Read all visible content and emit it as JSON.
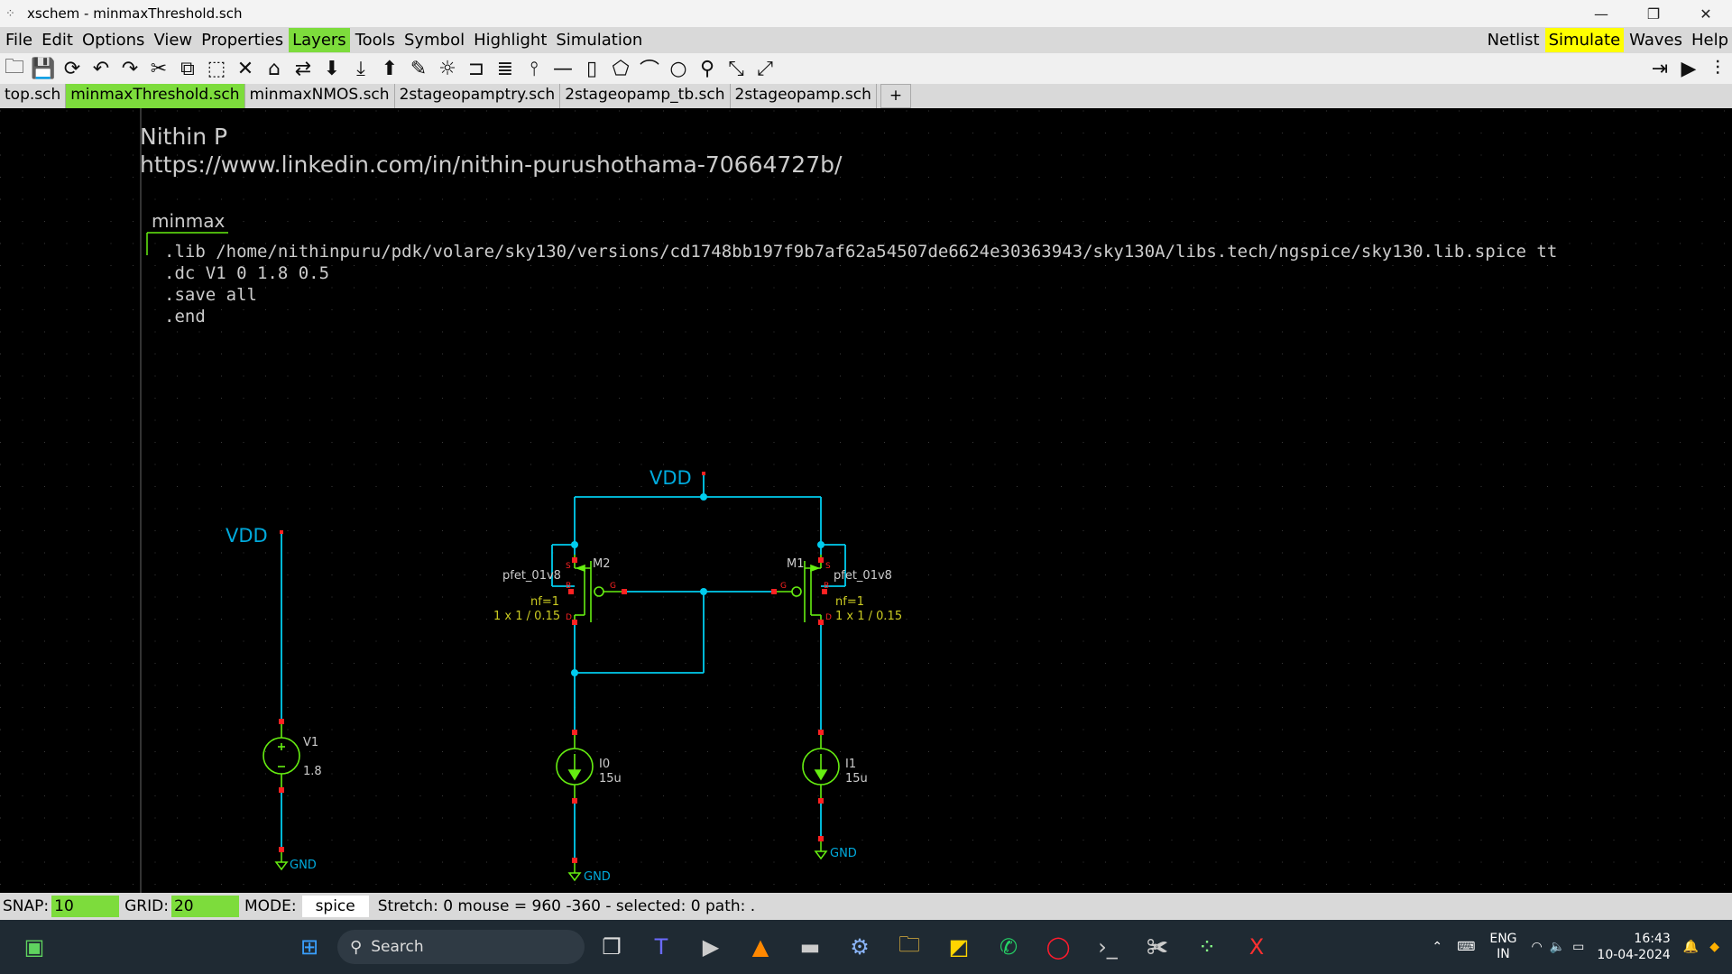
{
  "window": {
    "title": "xschem - minmaxThreshold.sch"
  },
  "menu": {
    "items": [
      "File",
      "Edit",
      "Options",
      "View",
      "Properties",
      "Layers",
      "Tools",
      "Symbol",
      "Highlight",
      "Simulation"
    ],
    "active": "Layers",
    "right": [
      "Netlist",
      "Simulate",
      "Waves",
      "Help"
    ]
  },
  "tabs": [
    "top.sch",
    "minmaxThreshold.sch",
    "minmaxNMOS.sch",
    "2stageopamptry.sch",
    "2stageopamp_tb.sch",
    "2stageopamp.sch",
    "+"
  ],
  "active_tab": "minmaxThreshold.sch",
  "schematic": {
    "author": "Nithin P",
    "link": "https://www.linkedin.com/in/nithin-purushothama-70664727b/",
    "code_block_title": "minmax",
    "code_lines": [
      ".lib /home/nithinpuru/pdk/volare/sky130/versions/cd1748bb197f9b7af62a54507de6624e30363943/sky130A/libs.tech/ngspice/sky130.lib.spice tt",
      ".dc V1 0 1.8 0.5",
      ".save all",
      ".end"
    ],
    "labels": {
      "vdd_top": "VDD",
      "vdd_left": "VDD",
      "gnd": "GND",
      "m2_name": "M2",
      "m2_model": "pfet_01v8",
      "m1_name": "M1",
      "m1_model": "pfet_01v8",
      "nf": "nf=1",
      "size": "1 x 1 / 0.15",
      "v1_name": "V1",
      "v1_value": "1.8",
      "i0_name": "I0",
      "i0_value": "15u",
      "i1_name": "I1",
      "i1_value": "15u",
      "pin_s": "S",
      "pin_g": "G",
      "pin_b": "B",
      "pin_d": "D"
    }
  },
  "status": {
    "snap_label": "SNAP:",
    "snap": "10",
    "grid_label": "GRID:",
    "grid": "20",
    "mode_label": "MODE:",
    "mode": "spice",
    "info": "Stretch: 0  mouse = 960 -360 - selected: 0 path: ."
  },
  "taskbar": {
    "search_placeholder": "Search",
    "lang1": "ENG",
    "lang2": "IN",
    "time": "16:43",
    "date": "10-04-2024"
  },
  "colors": {
    "wire": "#00ccee",
    "component": "#66ee11",
    "pin": "#ff2222",
    "label": "#00aadd",
    "accent": "#7ddc3c",
    "simulate": "#ffff00"
  }
}
